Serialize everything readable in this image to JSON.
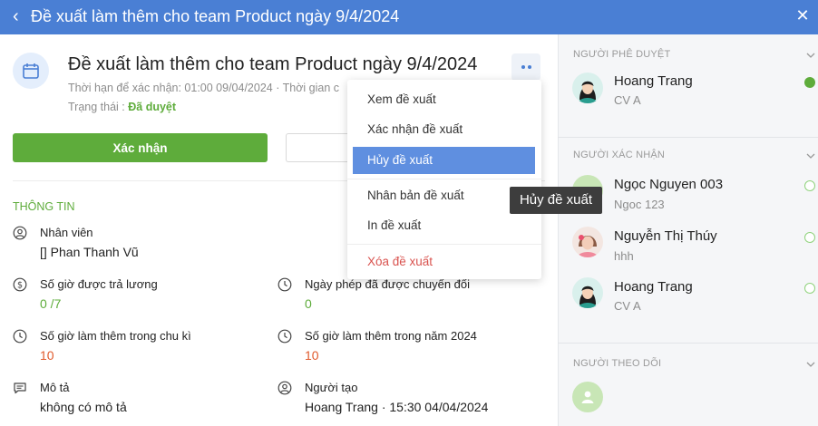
{
  "header": {
    "back_icon": "chevron-left-icon",
    "title": "Đề xuất làm thêm cho team Product ngày 9/4/2024",
    "close_icon": "close-icon"
  },
  "request": {
    "icon": "calendar-icon",
    "title": "Đề xuất làm thêm cho team Product ngày 9/4/2024",
    "meta": "Thời hạn để xác nhận: 01:00 09/04/2024 · Thời gian c",
    "status_label": "Trạng thái :",
    "status_value": "Đã duyệt"
  },
  "actions": {
    "confirm_label": "Xác nhận"
  },
  "info": {
    "section_title": "THÔNG TIN",
    "employee_label": "Nhân viên",
    "employee_value": "[] Phan Thanh Vũ",
    "paid_hours_label": "Số giờ được trả lương",
    "paid_hours_value": "0 /7",
    "converted_leave_label": "Ngày phép đã được chuyển đổi",
    "converted_leave_value": "0",
    "cycle_ot_label": "Số giờ làm thêm trong chu kì",
    "cycle_ot_value": "10",
    "year_ot_label": "Số giờ làm thêm trong năm 2024",
    "year_ot_value": "10",
    "desc_label": "Mô tả",
    "desc_value": "không có mô tả",
    "creator_label": "Người tạo",
    "creator_value": "Hoang Trang · 15:30 04/04/2024"
  },
  "menu": {
    "items": [
      "Xem đề xuất",
      "Xác nhận đề xuất",
      "Hủy đề xuất",
      "Nhân bản đề xuất",
      "In đề xuất",
      "Xóa đề xuất"
    ],
    "active_index": 2
  },
  "tooltip": "Hủy đề xuất",
  "sidebar": {
    "approvers_title": "NGƯỜI PHÊ DUYỆT",
    "approvers": [
      {
        "name": "Hoang Trang",
        "role": "CV A"
      }
    ],
    "confirmers_title": "NGƯỜI XÁC NHẬN",
    "confirmers": [
      {
        "name": "Ngọc Nguyen 003",
        "role": "Ngoc 123"
      },
      {
        "name": "Nguyễn Thị Thúy",
        "role": "hhh"
      },
      {
        "name": "Hoang Trang",
        "role": "CV A"
      }
    ],
    "followers_title": "NGƯỜI THEO DÕI"
  },
  "colors": {
    "header_bg": "#4a7fd4",
    "green": "#5eac3b",
    "red_value": "#e05a2c",
    "menu_active": "#5f8fe0",
    "danger": "#d9534f"
  }
}
